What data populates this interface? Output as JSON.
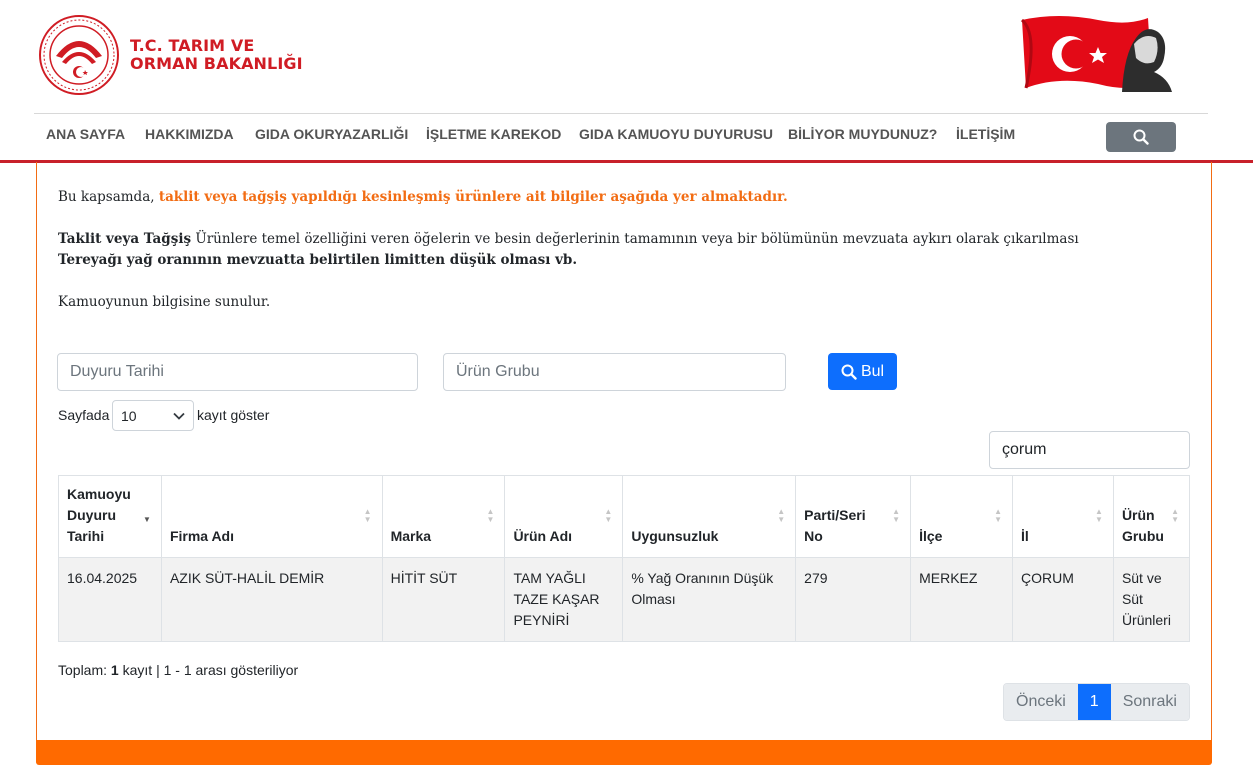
{
  "brand": {
    "line1": "T.C. TARIM VE",
    "line2": "ORMAN BAKANLIĞI"
  },
  "nav": {
    "items": [
      "ANA SAYFA",
      "HAKKIMIZDA",
      "GIDA OKURYAZARLIĞI",
      "İŞLETME KAREKOD",
      "GIDA KAMUOYU DUYURUSU",
      "BİLİYOR MUYDUNUZ?",
      "İLETİŞİM"
    ]
  },
  "intro": {
    "p1_prefix": "Bu kapsamda, ",
    "p1_highlight": "taklit veya tağşiş yapıldığı kesinleşmiş ürünlere ait bilgiler aşağıda yer almaktadır.",
    "p2_bold": "Taklit veya Tağşiş",
    "p2_text": " Ürünlere temel özelliğini veren öğelerin ve besin değerlerinin tamamının veya bir bölümünün mevzuata aykırı olarak çıkarılması",
    "p3_bold": "Tereyağı yağ oranının mevzuatta belirtilen limitten düşük olması vb.",
    "p4": "Kamuoyunun bilgisine sunulur."
  },
  "filters": {
    "date_placeholder": "Duyuru Tarihi",
    "group_placeholder": "Ürün Grubu",
    "search_label": "Bul"
  },
  "length": {
    "prefix": "Sayfada",
    "value": "10",
    "suffix": "kayıt göster"
  },
  "table_filter": {
    "value": "çorum"
  },
  "table": {
    "headers": [
      [
        "Kamuoyu",
        "Duyuru",
        "Tarihi"
      ],
      [
        "Firma Adı"
      ],
      [
        "Marka"
      ],
      [
        "Ürün Adı"
      ],
      [
        "Uygunsuzluk"
      ],
      [
        "Parti/Seri",
        "No"
      ],
      [
        "İlçe"
      ],
      [
        "İl"
      ],
      [
        "Ürün",
        "Grubu"
      ]
    ],
    "rows": [
      [
        [
          "16.04.2025"
        ],
        [
          "AZIK SÜT-HALİL DEMİR"
        ],
        [
          "HİTİT SÜT"
        ],
        [
          "TAM YAĞLI",
          "TAZE KAŞAR",
          "PEYNİRİ"
        ],
        [
          "% Yağ Oranının Düşük",
          "Olması"
        ],
        [
          "279"
        ],
        [
          "MERKEZ"
        ],
        [
          "ÇORUM"
        ],
        [
          "Süt ve",
          "Süt",
          "Ürünleri"
        ]
      ]
    ]
  },
  "summary": {
    "prefix": "Toplam: ",
    "count": "1",
    "suffix": " kayıt | 1 - 1 arası gösteriliyor"
  },
  "pagination": {
    "prev": "Önceki",
    "page": "1",
    "next": "Sonraki"
  },
  "colors": {
    "brand_red": "#d01c24",
    "accent_orange": "#ff6a00",
    "primary_blue": "#0d6efd"
  },
  "icons": {
    "search": "magnifier-icon",
    "dropdown": "chevron-down-icon"
  }
}
